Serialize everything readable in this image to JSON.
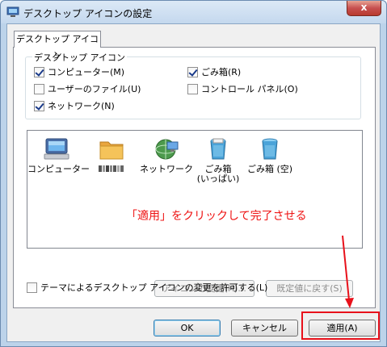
{
  "window": {
    "title": "デスクトップ アイコンの設定",
    "close_glyph": "x"
  },
  "tab": {
    "label": "デスクトップ アイコン"
  },
  "group": {
    "legend": "デスクトップ アイコン",
    "checkboxes": [
      {
        "label": "コンピューター(M)",
        "checked": true
      },
      {
        "label": "ごみ箱(R)",
        "checked": true
      },
      {
        "label": "ユーザーのファイル(U)",
        "checked": false
      },
      {
        "label": "コントロール パネル(O)",
        "checked": false
      },
      {
        "label": "ネットワーク(N)",
        "checked": true
      }
    ]
  },
  "icons": [
    {
      "icon": "computer-icon",
      "label": "コンピューター"
    },
    {
      "icon": "user-folder-icon",
      "label": ""
    },
    {
      "icon": "network-icon",
      "label": "ネットワーク"
    },
    {
      "icon": "recycle-bin-full-icon",
      "label": "ごみ箱\n(いっぱい)"
    },
    {
      "icon": "recycle-bin-empty-icon",
      "label": "ごみ箱 (空)"
    }
  ],
  "annotation": {
    "text": "「適用」をクリックして完了させる",
    "color": "#ee1111"
  },
  "buttons": {
    "change_icon": "アイコンの変更(H)...",
    "restore_default": "既定値に戻す(S)",
    "ok": "OK",
    "cancel": "キャンセル",
    "apply": "適用(A)"
  },
  "allow_themes": {
    "label": "テーマによるデスクトップ アイコンの変更を許可する(L)",
    "checked": false
  },
  "colors": {
    "accent_red": "#e8111b",
    "window_frame": "#bcd3ea"
  }
}
